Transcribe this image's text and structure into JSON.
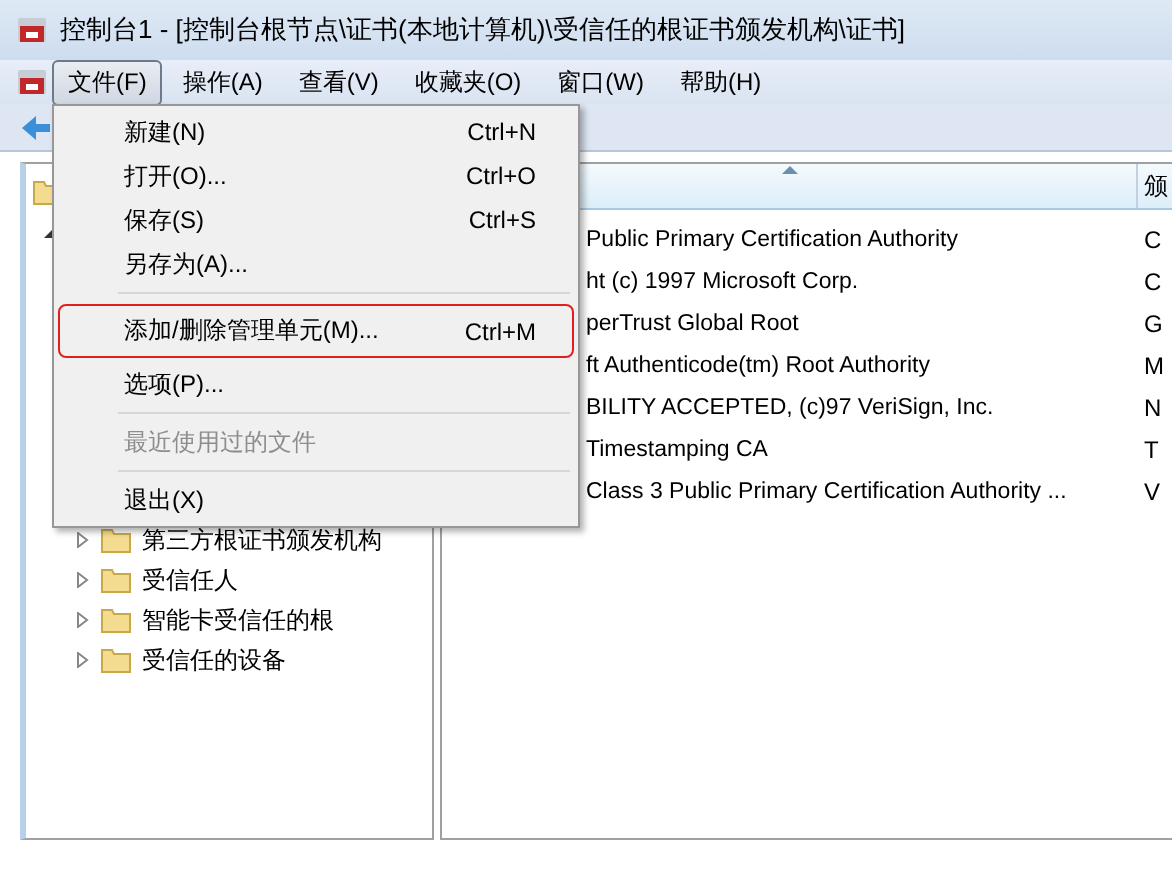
{
  "window": {
    "title": "控制台1 - [控制台根节点\\证书(本地计算机)\\受信任的根证书颁发机构\\证书]"
  },
  "menubar": [
    {
      "label": "文件(F)",
      "selected": true
    },
    {
      "label": "操作(A)",
      "selected": false
    },
    {
      "label": "查看(V)",
      "selected": false
    },
    {
      "label": "收藏夹(O)",
      "selected": false
    },
    {
      "label": "窗口(W)",
      "selected": false
    },
    {
      "label": "帮助(H)",
      "selected": false
    }
  ],
  "file_menu": [
    {
      "kind": "item",
      "label": "新建(N)",
      "shortcut": "Ctrl+N",
      "disabled": false,
      "annotated": false
    },
    {
      "kind": "item",
      "label": "打开(O)...",
      "shortcut": "Ctrl+O",
      "disabled": false,
      "annotated": false
    },
    {
      "kind": "item",
      "label": "保存(S)",
      "shortcut": "Ctrl+S",
      "disabled": false,
      "annotated": false
    },
    {
      "kind": "item",
      "label": "另存为(A)...",
      "disabled": false,
      "annotated": false
    },
    {
      "kind": "separator"
    },
    {
      "kind": "item",
      "label": "添加/删除管理单元(M)...",
      "shortcut": "Ctrl+M",
      "disabled": false,
      "annotated": true
    },
    {
      "kind": "item",
      "label": "选项(P)...",
      "disabled": false,
      "annotated": false
    },
    {
      "kind": "separator"
    },
    {
      "kind": "item",
      "label": "最近使用过的文件",
      "disabled": true,
      "annotated": false
    },
    {
      "kind": "separator"
    },
    {
      "kind": "item",
      "label": "退出(X)",
      "disabled": false,
      "annotated": false
    }
  ],
  "tree": {
    "items": [
      {
        "label": "第三方根证书颁发机构",
        "expanded": false
      },
      {
        "label": "受信任人",
        "expanded": false
      },
      {
        "label": "智能卡受信任的根",
        "expanded": false
      },
      {
        "label": "受信任的设备",
        "expanded": false
      }
    ]
  },
  "list": {
    "columns": [
      "",
      "颁"
    ],
    "rows": [
      [
        "Public Primary Certification Authority",
        "C"
      ],
      [
        "ht (c) 1997 Microsoft Corp.",
        "C"
      ],
      [
        "perTrust Global Root",
        "G"
      ],
      [
        "ft Authenticode(tm) Root Authority",
        "M"
      ],
      [
        "BILITY ACCEPTED, (c)97 VeriSign, Inc.",
        "N"
      ],
      [
        "Timestamping CA",
        "T"
      ],
      [
        "Class 3 Public Primary Certification Authority ...",
        "V"
      ]
    ]
  }
}
